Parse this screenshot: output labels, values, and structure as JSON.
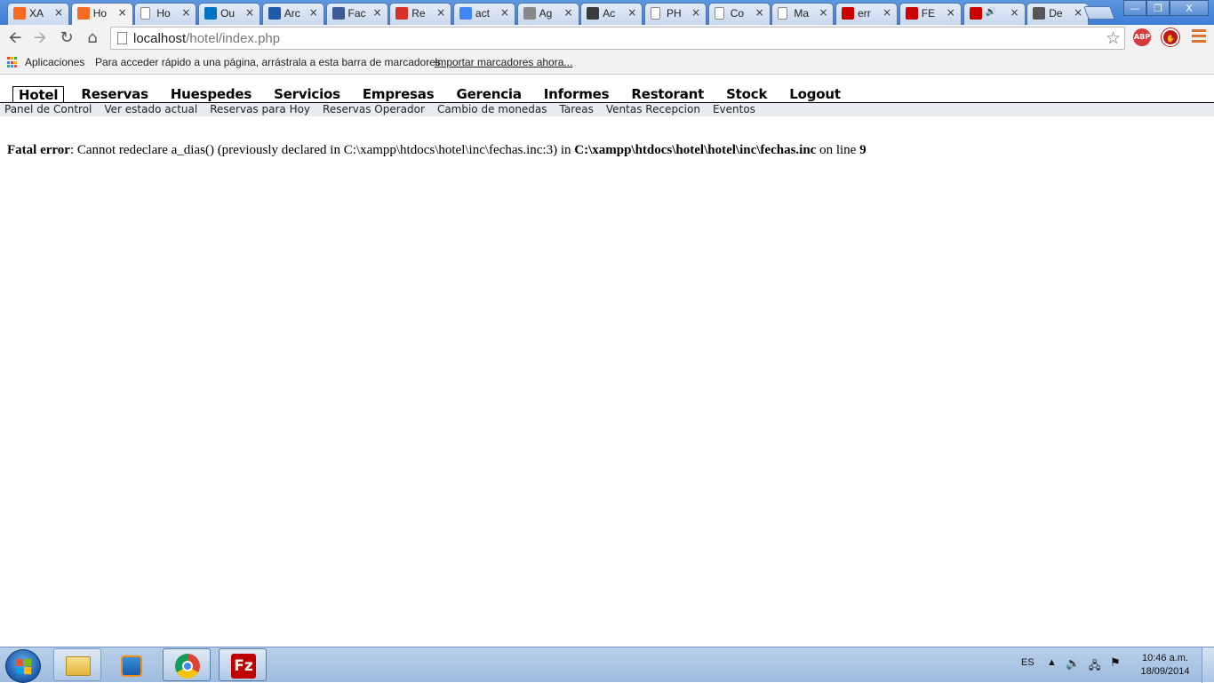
{
  "browser": {
    "tabs": [
      {
        "title": "XA",
        "icon": "xampp-icon",
        "color": "#f46b21"
      },
      {
        "title": "Ho",
        "icon": "xampp-icon",
        "color": "#f46b21",
        "active": true
      },
      {
        "title": "Ho",
        "icon": "page-icon",
        "color": "#ffffff"
      },
      {
        "title": "Ou",
        "icon": "outlook-icon",
        "color": "#0072c6"
      },
      {
        "title": "Arc",
        "icon": "onedrive-icon",
        "color": "#1f5aa8"
      },
      {
        "title": "Fac",
        "icon": "facebook-icon",
        "color": "#3b5998"
      },
      {
        "title": "Re",
        "icon": "gmail-icon",
        "color": "#d93025"
      },
      {
        "title": "act",
        "icon": "google-icon",
        "color": "#4285f4"
      },
      {
        "title": "Ag",
        "icon": "code-icon",
        "color": "#888888"
      },
      {
        "title": "Ac",
        "icon": "translate-icon",
        "color": "#3b3b3b"
      },
      {
        "title": "PH",
        "icon": "page-icon",
        "color": "#ffffff"
      },
      {
        "title": "Co",
        "icon": "page-icon",
        "color": "#ffffff"
      },
      {
        "title": "Ma",
        "icon": "page-icon",
        "color": "#ffffff"
      },
      {
        "title": "err",
        "icon": "youtube-icon",
        "color": "#cc0000"
      },
      {
        "title": "FE",
        "icon": "youtube-icon",
        "color": "#cc0000"
      },
      {
        "title": "",
        "icon": "youtube-icon",
        "color": "#cc0000",
        "audio": true
      },
      {
        "title": "De",
        "icon": "download-icon",
        "color": "#555555"
      }
    ],
    "url_host": "localhost",
    "url_path": "/hotel/index.php",
    "extensions": {
      "abp_label": "ABP"
    },
    "bookmarks": {
      "apps_label": "Aplicaciones",
      "hint": "Para acceder rápido a una página, arrástrala a esta barra de marcadores.",
      "import_link": "Importar marcadores ahora..."
    }
  },
  "page": {
    "main_nav": [
      "Hotel",
      "Reservas",
      "Huespedes",
      "Servicios",
      "Empresas",
      "Gerencia",
      "Informes",
      "Restorant",
      "Stock",
      "Logout"
    ],
    "active_nav": "Hotel",
    "sub_nav": [
      "Panel de Control",
      "Ver estado actual",
      "Reservas para Hoy",
      "Reservas Operador",
      "Cambio de monedas",
      "Tareas",
      "Ventas Recepcion",
      "Eventos"
    ],
    "error": {
      "label": "Fatal error",
      "message": ": Cannot redeclare a_dias() (previously declared in C:\\xampp\\htdocs\\hotel\\inc\\fechas.inc:3) in ",
      "file": "C:\\xampp\\htdocs\\hotel\\hotel\\inc\\fechas.inc",
      "line_prefix": " on line ",
      "line": "9"
    }
  },
  "taskbar": {
    "language": "ES",
    "time": "10:46 a.m.",
    "date": "18/09/2014",
    "items": [
      "explorer-icon",
      "media-player-icon",
      "chrome-icon",
      "filezilla-icon"
    ]
  }
}
